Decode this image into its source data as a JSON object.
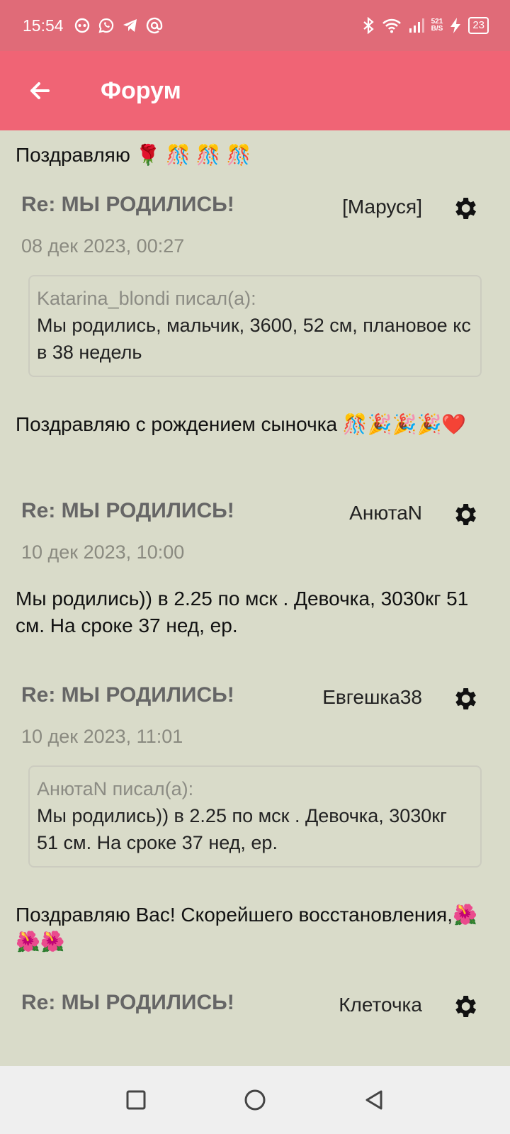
{
  "status_bar": {
    "time": "15:54",
    "net_speed_value": "521",
    "net_speed_unit": "B/S",
    "battery": "23",
    "left_icons": [
      "vpn-icon",
      "whatsapp-icon",
      "telegram-icon",
      "at-icon"
    ],
    "right_icons": [
      "bluetooth-icon",
      "wifi-icon",
      "signal-icon",
      "charging-icon"
    ]
  },
  "app_bar": {
    "title": "Форум",
    "back_icon": "arrow-left-icon",
    "color": "#f06475"
  },
  "intro_text": "Поздравляю 🌹 🎊 🎊 🎊",
  "posts": [
    {
      "title": "Re: МЫ РОДИЛИСЬ!",
      "author": "[Маруся]",
      "date": "08 дек 2023, 00:27",
      "quote": {
        "author": "Katarina_blondi писал(а):",
        "text": "Мы родились, мальчик, 3600, 52 см, плановое кс в 38 недель"
      },
      "text": "Поздравляю с рождением сыночка 🎊🎉🎉🎉❤️"
    },
    {
      "title": "Re: МЫ РОДИЛИСЬ!",
      "author": "АнютаN",
      "date": "10 дек 2023, 10:00",
      "text": "Мы родились)) в 2.25 по мск . Девочка, 3030кг 51 см. На сроке 37 нед, ер."
    },
    {
      "title": "Re: МЫ РОДИЛИСЬ!",
      "author": "Евгешка38",
      "date": "10 дек 2023, 11:01",
      "quote": {
        "author": "АнютаN писал(а):",
        "text": "Мы родились)) в 2.25 по мск . Девочка, 3030кг 51 см. На сроке 37 нед, ер."
      },
      "text": "Поздравляю Вас! Скорейшего восстановления,🌺🌺🌺"
    },
    {
      "title": "Re: МЫ РОДИЛИСЬ!",
      "author": "Клеточка"
    }
  ],
  "nav_bar": {
    "icons": [
      "recents-square-icon",
      "home-circle-icon",
      "back-triangle-icon"
    ]
  }
}
